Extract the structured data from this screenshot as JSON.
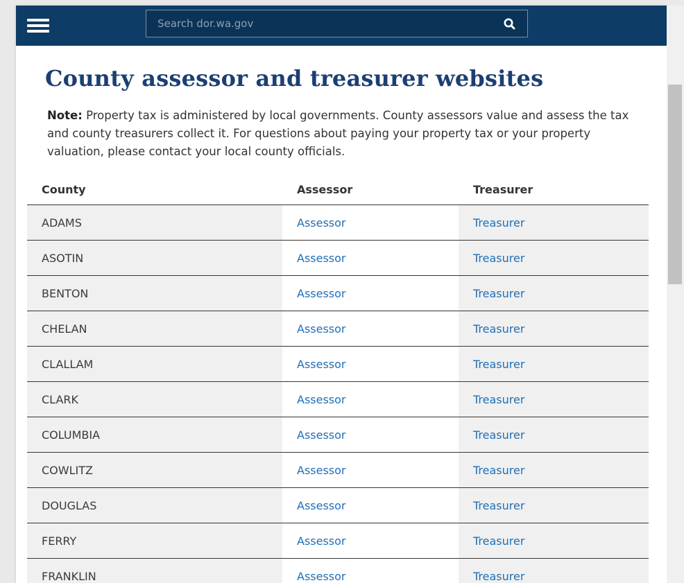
{
  "header": {
    "search_placeholder": "Search dor.wa.gov"
  },
  "page": {
    "title": "County assessor and treasurer websites",
    "note_label": "Note:",
    "note_text": " Property tax is administered by local governments.  County assessors value and assess the tax and county treasurers collect it.  For questions about paying your property tax or your property valuation, please contact your local county officials."
  },
  "table": {
    "headers": [
      "County",
      "Assessor",
      "Treasurer"
    ],
    "rows": [
      {
        "county": "ADAMS",
        "assessor": "Assessor",
        "treasurer": "Treasurer"
      },
      {
        "county": "ASOTIN",
        "assessor": "Assessor",
        "treasurer": "Treasurer"
      },
      {
        "county": "BENTON",
        "assessor": "Assessor",
        "treasurer": "Treasurer"
      },
      {
        "county": "CHELAN",
        "assessor": "Assessor",
        "treasurer": "Treasurer"
      },
      {
        "county": "CLALLAM",
        "assessor": "Assessor",
        "treasurer": "Treasurer"
      },
      {
        "county": "CLARK",
        "assessor": "Assessor",
        "treasurer": "Treasurer"
      },
      {
        "county": "COLUMBIA",
        "assessor": "Assessor",
        "treasurer": "Treasurer"
      },
      {
        "county": "COWLITZ",
        "assessor": "Assessor",
        "treasurer": "Treasurer"
      },
      {
        "county": "DOUGLAS",
        "assessor": "Assessor",
        "treasurer": "Treasurer"
      },
      {
        "county": "FERRY",
        "assessor": "Assessor",
        "treasurer": "Treasurer"
      },
      {
        "county": "FRANKLIN",
        "assessor": "Assessor",
        "treasurer": "Treasurer"
      }
    ]
  },
  "icons": {
    "menu": "hamburger-menu-icon",
    "search": "search-icon"
  },
  "colors": {
    "header_bg": "#0d3c66",
    "title": "#1c3f73",
    "link": "#1f6fb5",
    "row_shade": "#f0f0f0"
  }
}
